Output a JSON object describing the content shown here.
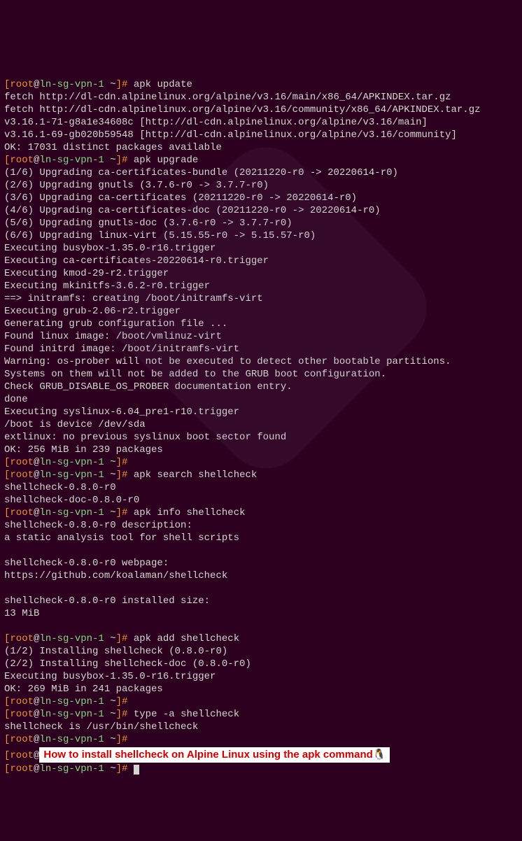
{
  "prompt": {
    "user": "root",
    "at": "@",
    "host": "ln-sg-vpn-1",
    "path": " ~",
    "open": "[",
    "close": "]# "
  },
  "cmd": {
    "update": "apk update",
    "upgrade": "apk upgrade",
    "search": "apk search shellcheck",
    "info": "apk info shellcheck",
    "add": "apk add shellcheck",
    "type": "type -a shellcheck"
  },
  "out": {
    "update": [
      "fetch http://dl-cdn.alpinelinux.org/alpine/v3.16/main/x86_64/APKINDEX.tar.gz",
      "fetch http://dl-cdn.alpinelinux.org/alpine/v3.16/community/x86_64/APKINDEX.tar.gz",
      "v3.16.1-71-g8a1e34608c [http://dl-cdn.alpinelinux.org/alpine/v3.16/main]",
      "v3.16.1-69-gb020b59548 [http://dl-cdn.alpinelinux.org/alpine/v3.16/community]",
      "OK: 17031 distinct packages available"
    ],
    "upgrade": [
      "(1/6) Upgrading ca-certificates-bundle (20211220-r0 -> 20220614-r0)",
      "(2/6) Upgrading gnutls (3.7.6-r0 -> 3.7.7-r0)",
      "(3/6) Upgrading ca-certificates (20211220-r0 -> 20220614-r0)",
      "(4/6) Upgrading ca-certificates-doc (20211220-r0 -> 20220614-r0)",
      "(5/6) Upgrading gnutls-doc (3.7.6-r0 -> 3.7.7-r0)",
      "(6/6) Upgrading linux-virt (5.15.55-r0 -> 5.15.57-r0)",
      "Executing busybox-1.35.0-r16.trigger",
      "Executing ca-certificates-20220614-r0.trigger",
      "Executing kmod-29-r2.trigger",
      "Executing mkinitfs-3.6.2-r0.trigger",
      "==> initramfs: creating /boot/initramfs-virt",
      "Executing grub-2.06-r2.trigger",
      "Generating grub configuration file ...",
      "Found linux image: /boot/vmlinuz-virt",
      "Found initrd image: /boot/initramfs-virt",
      "Warning: os-prober will not be executed to detect other bootable partitions.",
      "Systems on them will not be added to the GRUB boot configuration.",
      "Check GRUB_DISABLE_OS_PROBER documentation entry.",
      "done",
      "Executing syslinux-6.04_pre1-r10.trigger",
      "/boot is device /dev/sda",
      "extlinux: no previous syslinux boot sector found",
      "OK: 256 MiB in 239 packages"
    ],
    "search": [
      "shellcheck-0.8.0-r0",
      "shellcheck-doc-0.8.0-r0"
    ],
    "info": [
      "shellcheck-0.8.0-r0 description:",
      "a static analysis tool for shell scripts",
      "",
      "shellcheck-0.8.0-r0 webpage:",
      "https://github.com/koalaman/shellcheck",
      "",
      "shellcheck-0.8.0-r0 installed size:",
      "13 MiB",
      ""
    ],
    "add": [
      "(1/2) Installing shellcheck (0.8.0-r0)",
      "(2/2) Installing shellcheck-doc (0.8.0-r0)",
      "Executing busybox-1.35.0-r16.trigger",
      "OK: 269 MiB in 241 packages"
    ],
    "type": [
      "shellcheck is /usr/bin/shellcheck"
    ]
  },
  "banner": "How to install shellcheck on Alpine Linux using the apk command🐧"
}
